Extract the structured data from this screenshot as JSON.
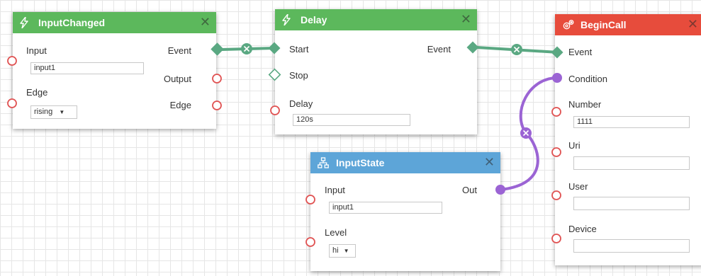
{
  "nodes": {
    "input_changed": {
      "title": "InputChanged",
      "header_color": "#5cb85c",
      "icon": "lightning-icon",
      "input_label": "Input",
      "input_value": "input1",
      "edge_label": "Edge",
      "edge_value": "rising",
      "event_label": "Event",
      "output_label": "Output",
      "edge_out_label": "Edge"
    },
    "delay": {
      "title": "Delay",
      "header_color": "#5cb85c",
      "icon": "lightning-icon",
      "start_label": "Start",
      "stop_label": "Stop",
      "event_label": "Event",
      "delay_label": "Delay",
      "delay_value": "120s"
    },
    "input_state": {
      "title": "InputState",
      "header_color": "#5da5d8",
      "icon": "hierarchy-icon",
      "input_label": "Input",
      "input_value": "input1",
      "level_label": "Level",
      "level_value": "hi",
      "out_label": "Out"
    },
    "begin_call": {
      "title": "BeginCall",
      "header_color": "#e74c3c",
      "icon": "gears-icon",
      "event_label": "Event",
      "condition_label": "Condition",
      "number_label": "Number",
      "number_value": "1111",
      "uri_label": "Uri",
      "uri_value": "",
      "user_label": "User",
      "user_value": "",
      "device_label": "Device",
      "device_value": ""
    }
  },
  "colors": {
    "event_wire": "#5aa882",
    "condition_wire": "#9b64d4",
    "port_ring": "#e05252"
  },
  "close_symbol": "✕",
  "dropdown_arrow": "▼"
}
